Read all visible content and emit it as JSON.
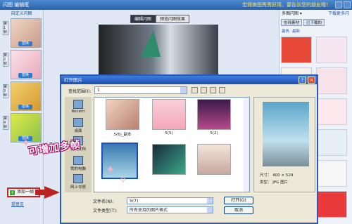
{
  "window": {
    "title": "闪图 编辑框",
    "hint": "觉得美图秀秀好用，要告诉您的朋友哦！"
  },
  "left": {
    "header": "自定义闪图",
    "frames": [
      {
        "label": "第1帧",
        "replace": "替换"
      },
      {
        "label": "第2帧",
        "replace": "替换"
      },
      {
        "label": "第3帧",
        "replace": "替换"
      },
      {
        "label": "第4帧",
        "replace": "替换"
      }
    ],
    "add_button": "添加一帧",
    "feedback": "提意见"
  },
  "center": {
    "tabs": [
      "编辑闪图",
      "预览闪图效果"
    ]
  },
  "right": {
    "dropdown": "多图闪图",
    "download_more": "下载更多闪",
    "tabs": [
      "在线素材",
      "已下载的"
    ],
    "subtabs": [
      "最热",
      "最新"
    ]
  },
  "dialog": {
    "title": "打开图片",
    "look_in_label": "查找范围(I):",
    "look_in_value": "1",
    "places": [
      "Recent",
      "桌面",
      "我的文档",
      "我的电脑",
      "网上邻居"
    ],
    "files": [
      "5(6)_副本",
      "5(5)",
      "5(2)",
      "",
      "",
      ""
    ],
    "preview": {
      "size": "尺寸： 400 × 529",
      "type": "类型： JPG 图片"
    },
    "filename_label": "文件名(N):",
    "filename_value": "5(7)",
    "filetype_label": "文件类型(T):",
    "filetype_value": "所有支持的图片格式",
    "open_button": "打开(O)",
    "cancel_button": "取消"
  },
  "overlay_text": "可增加多帧",
  "colors": {
    "accent": "#2b62a8",
    "highlight": "#cc2222",
    "overlay": "#b2005e"
  }
}
